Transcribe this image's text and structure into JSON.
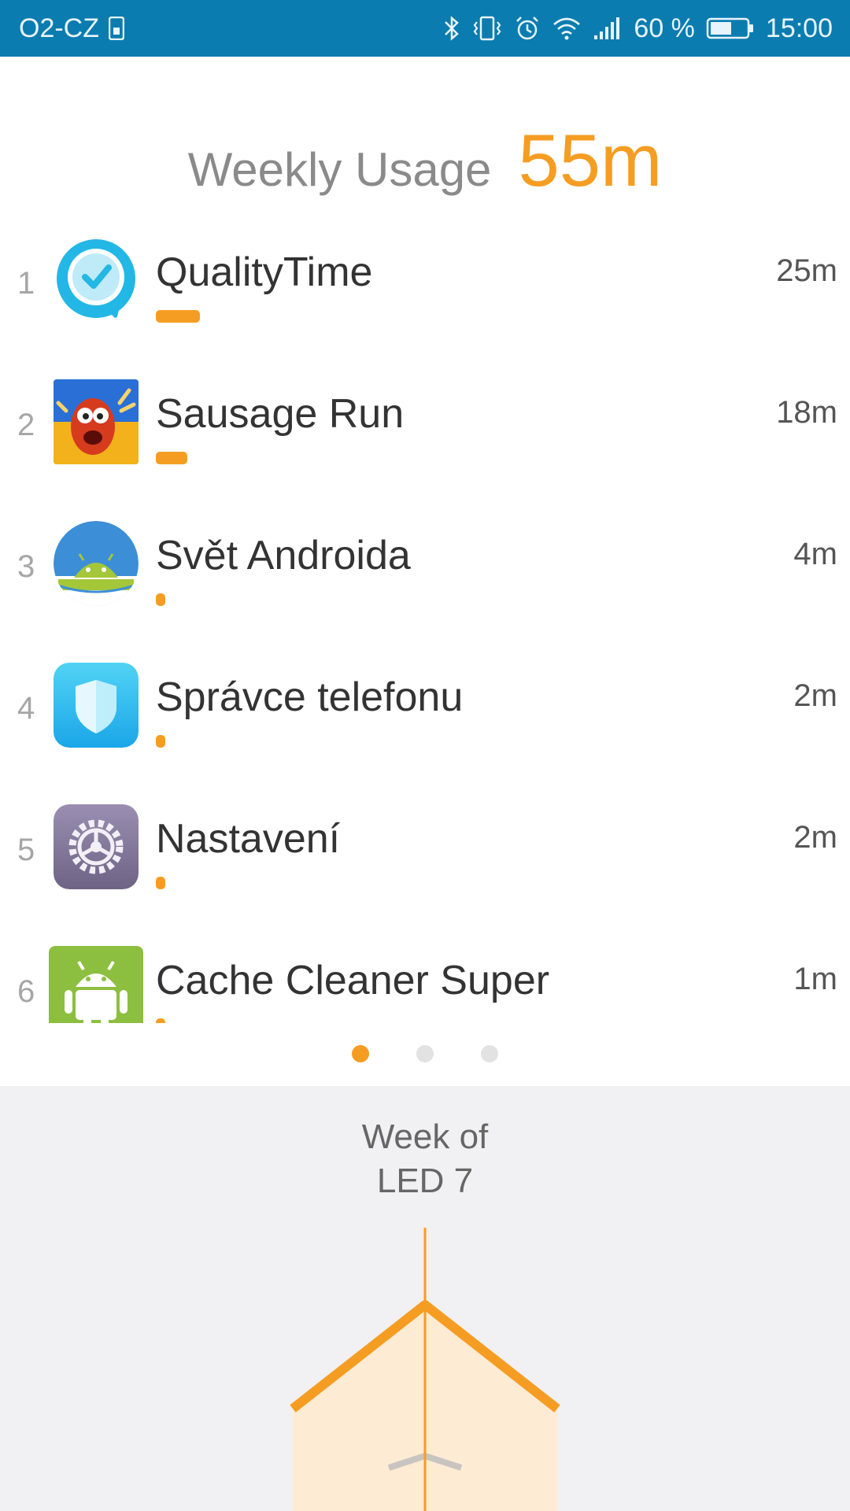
{
  "status_bar": {
    "carrier": "O2-CZ",
    "battery_percent": "60 %",
    "time": "15:00",
    "battery_level": 0.6,
    "icons": [
      "sim-icon",
      "bluetooth-icon",
      "vibrate-icon",
      "alarm-icon",
      "wifi-icon",
      "signal-icon",
      "battery-icon"
    ]
  },
  "header": {
    "label": "Weekly Usage",
    "total": "55m"
  },
  "apps": [
    {
      "rank": "1",
      "name": "QualityTime",
      "time": "25m",
      "share": 1.0,
      "icon": "qualitytime-icon"
    },
    {
      "rank": "2",
      "name": "Sausage Run",
      "time": "18m",
      "share": 0.72,
      "icon": "sausage-run-icon"
    },
    {
      "rank": "3",
      "name": "Svět Androida",
      "time": "4m",
      "share": 0.16,
      "icon": "svet-androida-icon"
    },
    {
      "rank": "4",
      "name": "Správce telefonu",
      "time": "2m",
      "share": 0.08,
      "icon": "shield-icon"
    },
    {
      "rank": "5",
      "name": "Nastavení",
      "time": "2m",
      "share": 0.08,
      "icon": "gear-icon"
    },
    {
      "rank": "6",
      "name": "Cache Cleaner Super",
      "time": "1m",
      "share": 0.04,
      "icon": "android-icon"
    }
  ],
  "pager": {
    "pages": 3,
    "active": 0
  },
  "week": {
    "line1": "Week of",
    "line2": "LED 7"
  },
  "colors": {
    "accent": "#f59d23",
    "status_bar": "#0b7cb0",
    "panel": "#f1f0f2"
  }
}
